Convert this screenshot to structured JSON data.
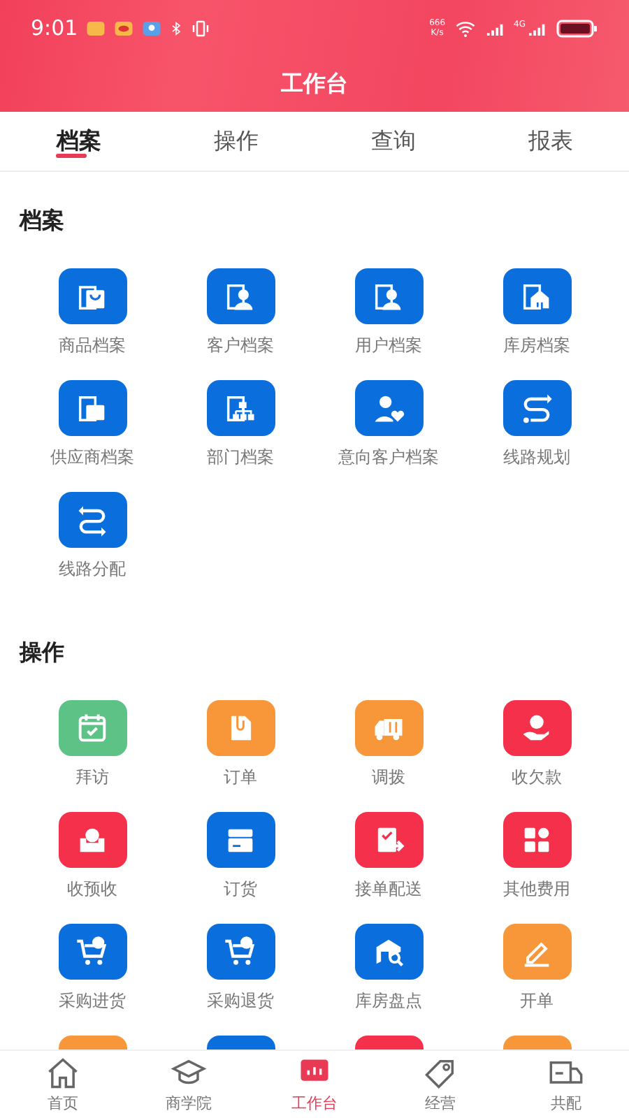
{
  "status_bar": {
    "time": "9:01",
    "speed": "666\nK/s",
    "network": "4G"
  },
  "header": {
    "title": "工作台"
  },
  "tabs": [
    {
      "label": "档案",
      "selected": true
    },
    {
      "label": "操作",
      "selected": false
    },
    {
      "label": "查询",
      "selected": false
    },
    {
      "label": "报表",
      "selected": false
    }
  ],
  "sections": [
    {
      "title": "档案",
      "items": [
        {
          "label": "商品档案",
          "color": "#0a6fdc"
        },
        {
          "label": "客户档案",
          "color": "#0a6fdc"
        },
        {
          "label": "用户档案",
          "color": "#0a6fdc"
        },
        {
          "label": "库房档案",
          "color": "#0a6fdc"
        },
        {
          "label": "供应商档案",
          "color": "#0a6fdc"
        },
        {
          "label": "部门档案",
          "color": "#0a6fdc"
        },
        {
          "label": "意向客户档案",
          "color": "#0a6fdc"
        },
        {
          "label": "线路规划",
          "color": "#0a6fdc"
        },
        {
          "label": "线路分配",
          "color": "#0a6fdc"
        }
      ]
    },
    {
      "title": "操作",
      "items": [
        {
          "label": "拜访",
          "color": "#5cc285"
        },
        {
          "label": "订单",
          "color": "#f8963a"
        },
        {
          "label": "调拨",
          "color": "#f8963a"
        },
        {
          "label": "收欠款",
          "color": "#f5304a"
        },
        {
          "label": "收预收",
          "color": "#f5304a"
        },
        {
          "label": "订货",
          "color": "#0a6fdc"
        },
        {
          "label": "接单配送",
          "color": "#f5304a"
        },
        {
          "label": "其他费用",
          "color": "#f5304a"
        },
        {
          "label": "采购进货",
          "color": "#0a6fdc"
        },
        {
          "label": "采购退货",
          "color": "#0a6fdc"
        },
        {
          "label": "库房盘点",
          "color": "#0a6fdc"
        },
        {
          "label": "开单",
          "color": "#f8963a"
        },
        {
          "color": "#f8963a"
        },
        {
          "color": "#0a6fdc"
        },
        {
          "color": "#f5304a"
        },
        {
          "color": "#f8963a"
        }
      ]
    }
  ],
  "bottom_nav": [
    {
      "label": "首页",
      "selected": false
    },
    {
      "label": "商学院",
      "selected": false
    },
    {
      "label": "工作台",
      "selected": true
    },
    {
      "label": "经营",
      "selected": false
    },
    {
      "label": "共配",
      "selected": false
    }
  ]
}
